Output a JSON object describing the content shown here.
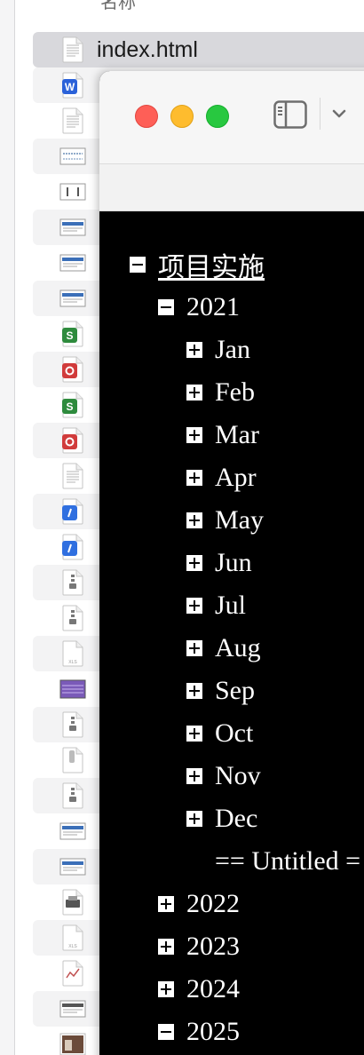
{
  "finder": {
    "column_header": "名称",
    "selected_file": "index.html",
    "files": [
      {
        "name": "index.html",
        "icon": "html-file-icon",
        "color": "#9aa0a6"
      },
      {
        "name": "",
        "icon": "word-doc-icon",
        "color": "#2b62d9"
      },
      {
        "name": "",
        "icon": "text-doc-icon",
        "color": "#9aa0a6"
      },
      {
        "name": "",
        "icon": "spreadsheet-preview-icon",
        "color": "#6b8fb8"
      },
      {
        "name": "",
        "icon": "window-preview-icon",
        "color": "#555555"
      },
      {
        "name": "",
        "icon": "screenshot-icon",
        "color": "#3b6fb8"
      },
      {
        "name": "",
        "icon": "screenshot-icon",
        "color": "#3b6fb8"
      },
      {
        "name": "",
        "icon": "screenshot-icon",
        "color": "#3b6fb8"
      },
      {
        "name": "",
        "icon": "numbers-icon",
        "color": "#2e8b3d"
      },
      {
        "name": "",
        "icon": "pdf-icon",
        "color": "#d13b3b"
      },
      {
        "name": "",
        "icon": "numbers-icon",
        "color": "#2e8b3d"
      },
      {
        "name": "",
        "icon": "pdf-icon",
        "color": "#d13b3b"
      },
      {
        "name": "",
        "icon": "text-doc-icon",
        "color": "#9aa0a6"
      },
      {
        "name": "",
        "icon": "keynote-icon",
        "color": "#2f6fe0"
      },
      {
        "name": "",
        "icon": "keynote-icon",
        "color": "#2f6fe0"
      },
      {
        "name": "",
        "icon": "archive-icon",
        "color": "#777777"
      },
      {
        "name": "",
        "icon": "archive-icon",
        "color": "#777777"
      },
      {
        "name": "",
        "icon": "xlsx-icon",
        "color": "#9aa0a6"
      },
      {
        "name": "",
        "icon": "image-icon",
        "color": "#7a5ab8"
      },
      {
        "name": "",
        "icon": "archive-icon",
        "color": "#777777"
      },
      {
        "name": "",
        "icon": "script-icon",
        "color": "#555555"
      },
      {
        "name": "",
        "icon": "archive-icon",
        "color": "#777777"
      },
      {
        "name": "",
        "icon": "screenshot-icon",
        "color": "#3b6fb8"
      },
      {
        "name": "",
        "icon": "screenshot-icon",
        "color": "#3b6fb8"
      },
      {
        "name": "",
        "icon": "printer-icon",
        "color": "#444444"
      },
      {
        "name": "",
        "icon": "xls-icon",
        "color": "#9aa0a6"
      },
      {
        "name": "",
        "icon": "chart-doc-icon",
        "color": "#c05050"
      },
      {
        "name": "",
        "icon": "screenshot-icon",
        "color": "#555555"
      },
      {
        "name": "",
        "icon": "photo-icon",
        "color": "#6b4b3a"
      }
    ]
  },
  "window": {
    "controls": [
      "close",
      "minimize",
      "zoom"
    ],
    "sidebar_toggle_icon": "sidebar-icon",
    "chevron_icon": "chevron-down-icon"
  },
  "tree": {
    "root": {
      "label": "项目实施",
      "state": "expanded"
    },
    "years": [
      {
        "label": "2021",
        "state": "expanded"
      },
      {
        "label": "2022",
        "state": "collapsed"
      },
      {
        "label": "2023",
        "state": "collapsed"
      },
      {
        "label": "2024",
        "state": "collapsed"
      },
      {
        "label": "2025",
        "state": "expanded"
      }
    ],
    "months": [
      {
        "label": "Jan",
        "state": "collapsed"
      },
      {
        "label": "Feb",
        "state": "collapsed"
      },
      {
        "label": "Mar",
        "state": "collapsed"
      },
      {
        "label": "Apr",
        "state": "collapsed"
      },
      {
        "label": "May",
        "state": "collapsed"
      },
      {
        "label": "Jun",
        "state": "collapsed"
      },
      {
        "label": "Jul",
        "state": "collapsed"
      },
      {
        "label": "Aug",
        "state": "collapsed"
      },
      {
        "label": "Sep",
        "state": "collapsed"
      },
      {
        "label": "Oct",
        "state": "collapsed"
      },
      {
        "label": "Nov",
        "state": "collapsed"
      },
      {
        "label": "Dec",
        "state": "collapsed"
      }
    ],
    "untitled": "== Untitled ="
  }
}
